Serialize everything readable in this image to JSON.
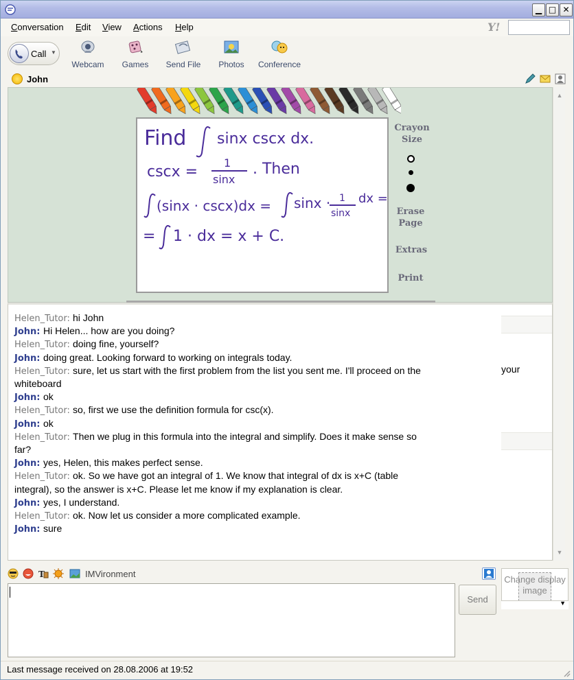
{
  "window": {
    "minimize_glyph": "▁",
    "maximize_glyph": "□",
    "close_glyph": "✕"
  },
  "menu": [
    {
      "first": "C",
      "rest": "onversation"
    },
    {
      "first": "E",
      "rest": "dit"
    },
    {
      "first": "V",
      "rest": "iew"
    },
    {
      "first": "A",
      "rest": "ctions"
    },
    {
      "first": "H",
      "rest": "elp"
    }
  ],
  "yahoo_logo": "Y!",
  "toolbar": {
    "call_label": "Call",
    "call_arrow": "▼",
    "items": [
      {
        "label": "Webcam",
        "icon": "webcam-icon"
      },
      {
        "label": "Games",
        "icon": "games-icon"
      },
      {
        "label": "Send File",
        "icon": "send-file-icon"
      },
      {
        "label": "Photos",
        "icon": "photos-icon"
      },
      {
        "label": "Conference",
        "icon": "conference-icon"
      }
    ]
  },
  "contact": {
    "name": "John"
  },
  "whiteboard": {
    "side_labels": {
      "crayon_size": "Crayon Size",
      "erase_page": "Erase Page",
      "extras": "Extras",
      "print": "Print"
    },
    "handwriting": {
      "line1_a": "Find",
      "line1_b": "sinx cscx dx.",
      "line2_a": "cscx =",
      "line2_num": "1",
      "line2_den": "sinx",
      "line2_b": ".  Then",
      "line3_a": "(sinx · cscx)dx =",
      "line3_b": "sinx ·",
      "line3_num": "1",
      "line3_den": "sinx",
      "line3_c": "dx =",
      "line4_a": "=",
      "line4_b": "1 · dx = x + C."
    },
    "crayon_colors": [
      "#e23c2c",
      "#f06a1e",
      "#f8a21c",
      "#f4d80e",
      "#8cc63e",
      "#2ca44a",
      "#1e9a8a",
      "#2c8fd6",
      "#2a4fb5",
      "#6a3aa6",
      "#a24aa8",
      "#d86a9e",
      "#8e5a34",
      "#5a3a22",
      "#2a2a2a",
      "#7a7a7a",
      "#b8b8b8",
      "#ffffff"
    ]
  },
  "messages": [
    {
      "sender": "Helen_Tutor",
      "text": "hi John"
    },
    {
      "sender": "John",
      "text": "Hi Helen... how are you doing?"
    },
    {
      "sender": "Helen_Tutor",
      "text": "doing fine, yourself?"
    },
    {
      "sender": "John",
      "text": "doing great. Looking forward to working on integrals today."
    },
    {
      "sender": "Helen_Tutor",
      "text": "sure, let us start with the first problem from the list you sent me. I'll proceed on the"
    },
    {
      "sender": "",
      "text": "whiteboard"
    },
    {
      "sender": "John",
      "text": "ok"
    },
    {
      "sender": "Helen_Tutor",
      "text": "so, first we use the definition formula for csc(x)."
    },
    {
      "sender": "John",
      "text": "ok"
    },
    {
      "sender": "Helen_Tutor",
      "text": "Then we plug in this formula into the integral and simplify. Does it make sense so"
    },
    {
      "sender": "",
      "text": "far?"
    },
    {
      "sender": "John",
      "text": "yes, Helen, this makes perfect sense."
    },
    {
      "sender": "Helen_Tutor",
      "text": "ok. So we have got an integral of 1. We know that integral of dx is x+C (table"
    },
    {
      "sender": "",
      "text": "integral), so the answer is x+C. Please let me know if my explanation is clear."
    },
    {
      "sender": "John",
      "text": "yes, I understand."
    },
    {
      "sender": "Helen_Tutor",
      "text": "ok. Now let us consider a more complicated example."
    },
    {
      "sender": "John",
      "text": "sure"
    }
  ],
  "overflow_word": "your",
  "imvironment_label": "IMVironment",
  "send_label": "Send",
  "display_image": {
    "label": "Change display image"
  },
  "status": {
    "text": "Last message received on 28.08.2006 at 19:52"
  },
  "colors": {
    "title_bar": "#b4bde7",
    "whiteboard_bg": "#d6e2d6",
    "john_name": "#2f3f8f",
    "helen_name": "#777777",
    "ink": "#4a2c9a"
  }
}
